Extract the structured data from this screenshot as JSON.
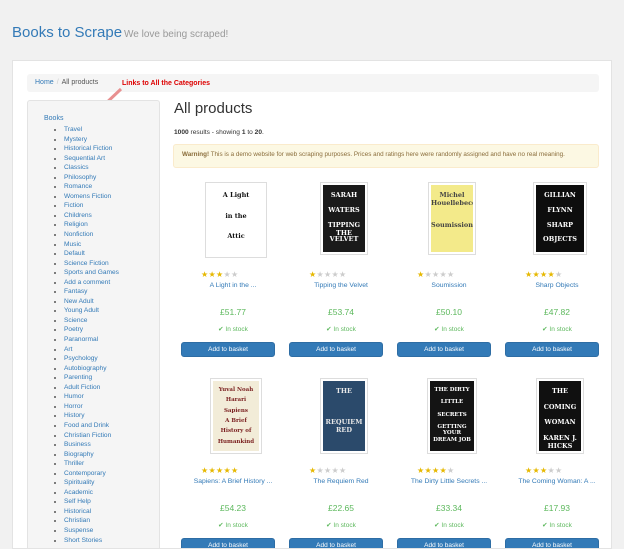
{
  "header": {
    "brand": "Books to Scrape",
    "tagline": "We love being scraped!"
  },
  "breadcrumb": {
    "home": "Home",
    "current": "All products"
  },
  "annotation": "Links to All the Categories",
  "sidebar": {
    "root": "Books",
    "categories": [
      "Travel",
      "Mystery",
      "Historical Fiction",
      "Sequential Art",
      "Classics",
      "Philosophy",
      "Romance",
      "Womens Fiction",
      "Fiction",
      "Childrens",
      "Religion",
      "Nonfiction",
      "Music",
      "Default",
      "Science Fiction",
      "Sports and Games",
      "Add a comment",
      "Fantasy",
      "New Adult",
      "Young Adult",
      "Science",
      "Poetry",
      "Paranormal",
      "Art",
      "Psychology",
      "Autobiography",
      "Parenting",
      "Adult Fiction",
      "Humor",
      "Horror",
      "History",
      "Food and Drink",
      "Christian Fiction",
      "Business",
      "Biography",
      "Thriller",
      "Contemporary",
      "Spirituality",
      "Academic",
      "Self Help",
      "Historical",
      "Christian",
      "Suspense",
      "Short Stories"
    ]
  },
  "main": {
    "heading": "All products",
    "results_count": "1000",
    "results_mid": " results - showing ",
    "results_from": "1",
    "results_to_word": " to ",
    "results_to": "20",
    "results_end": ".",
    "warning_label": "Warning!",
    "warning_text": " This is a demo website for web scraping purposes. Prices and ratings here were randomly assigned and have no real meaning."
  },
  "products": [
    {
      "title": "A Light in the ...",
      "price": "£51.77",
      "stock": "In stock",
      "rating": 3,
      "button": "Add to basket",
      "cover": {
        "bg": "#ffffff",
        "fg": "#111111",
        "lines": [
          "A Light",
          "in the",
          "Attic"
        ]
      }
    },
    {
      "title": "Tipping the Velvet",
      "price": "£53.74",
      "stock": "In stock",
      "rating": 1,
      "button": "Add to basket",
      "cover": {
        "bg": "#1a1a1a",
        "fg": "#ffffff",
        "lines": [
          "SARAH",
          "WATERS",
          "TIPPING THE",
          "VELVET"
        ]
      }
    },
    {
      "title": "Soumission",
      "price": "£50.10",
      "stock": "In stock",
      "rating": 1,
      "button": "Add to basket",
      "cover": {
        "bg": "#f3ea8a",
        "fg": "#444444",
        "lines": [
          "Michel Houellebecq",
          "Soumission"
        ]
      }
    },
    {
      "title": "Sharp Objects",
      "price": "£47.82",
      "stock": "In stock",
      "rating": 4,
      "button": "Add to basket",
      "cover": {
        "bg": "#0d0d0d",
        "fg": "#ffffff",
        "lines": [
          "GILLIAN",
          "FLYNN",
          "SHARP",
          "OBJECTS"
        ]
      }
    },
    {
      "title": "Sapiens: A Brief History ...",
      "price": "£54.23",
      "stock": "In stock",
      "rating": 5,
      "button": "Add to basket",
      "cover": {
        "bg": "#f2ecd8",
        "fg": "#7a1f1f",
        "lines": [
          "Yuval Noah",
          "Harari",
          "Sapiens",
          "A Brief",
          "History of",
          "Humankind"
        ]
      }
    },
    {
      "title": "The Requiem Red",
      "price": "£22.65",
      "stock": "In stock",
      "rating": 1,
      "button": "Add to basket",
      "cover": {
        "bg": "#2b4a6b",
        "fg": "#e8e8e8",
        "lines": [
          "THE",
          "REQUIEM RED"
        ]
      }
    },
    {
      "title": "The Dirty Little Secrets ...",
      "price": "£33.34",
      "stock": "In stock",
      "rating": 4,
      "button": "Add to basket",
      "cover": {
        "bg": "#141414",
        "fg": "#ffffff",
        "lines": [
          "THE DIRTY",
          "LITTLE",
          "SECRETS",
          "GETTING YOUR",
          "DREAM JOB"
        ]
      }
    },
    {
      "title": "The Coming Woman: A ...",
      "price": "£17.93",
      "stock": "In stock",
      "rating": 3,
      "button": "Add to basket",
      "cover": {
        "bg": "#101010",
        "fg": "#ffffff",
        "lines": [
          "THE",
          "COMING",
          "WOMAN",
          "KAREN J. HICKS"
        ]
      }
    }
  ]
}
